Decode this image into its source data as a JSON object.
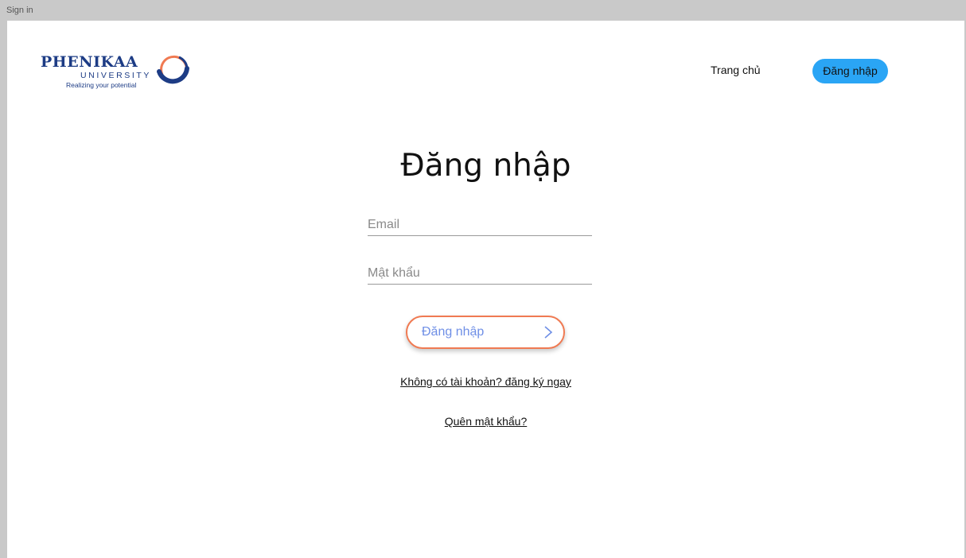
{
  "window": {
    "title": "Sign in"
  },
  "logo": {
    "wordmark": "PHENIKAA",
    "subtitle": "UNIVERSITY",
    "tagline": "Realizing your potential",
    "icon": "ring-logo-icon",
    "colors": {
      "blue": "#1d3c85",
      "orange": "#f07a52"
    }
  },
  "nav": {
    "home_label": "Trang chủ",
    "login_label": "Đăng nhập",
    "login_color": "#2aa5f5"
  },
  "form": {
    "title": "Đăng nhập",
    "email_placeholder": "Email",
    "password_placeholder": "Mật khẩu",
    "submit_label": "Đăng nhập",
    "submit_icon": "chevron-right-icon",
    "register_link": "Không có tài khoản? đăng ký ngay",
    "forgot_link": "Quên mật khẩu?",
    "accent_color": "#f07a52",
    "button_text_color": "#6f8fe6"
  }
}
